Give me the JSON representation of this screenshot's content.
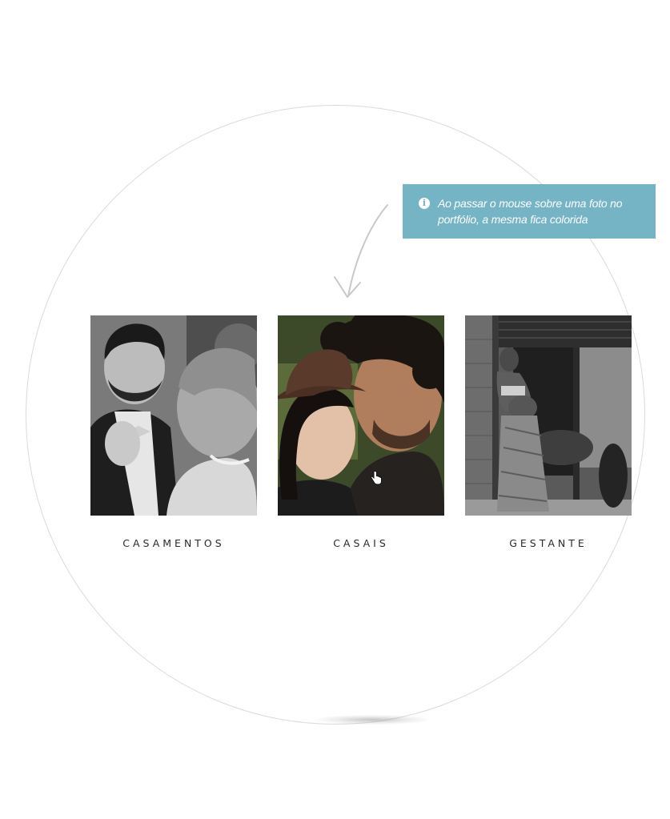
{
  "tooltip": {
    "icon": "info-icon",
    "line1": "Ao  passar o mouse sobre uma foto no",
    "line2": "portfólio, a mesma fica colorida",
    "color": "#75b4c4"
  },
  "gallery": [
    {
      "label": "CASAMENTOS",
      "style": "grayscale"
    },
    {
      "label": "CASAIS",
      "style": "color"
    },
    {
      "label": "GESTANTE",
      "style": "grayscale"
    }
  ]
}
